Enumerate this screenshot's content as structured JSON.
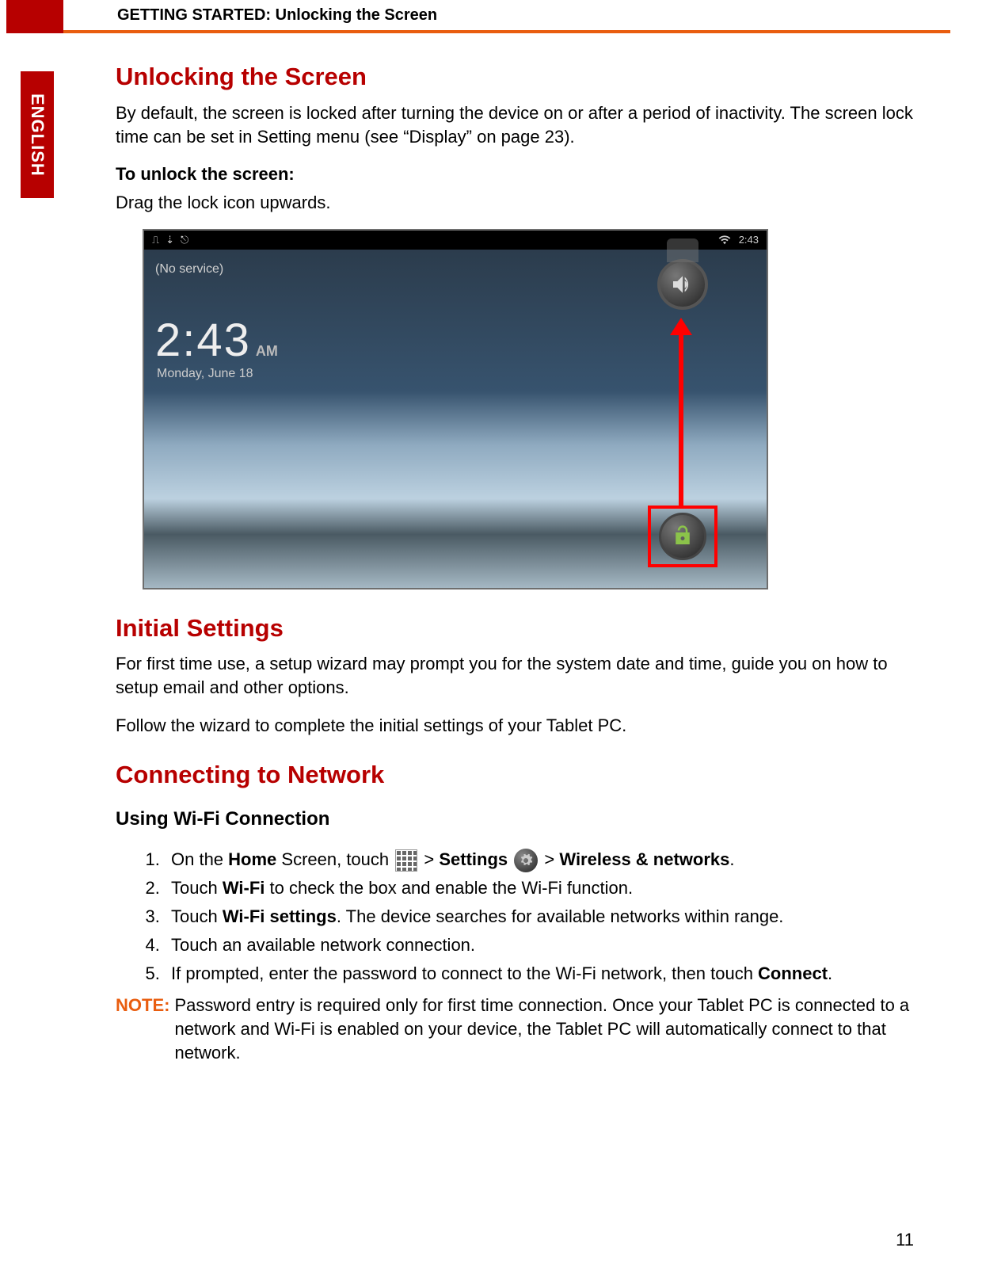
{
  "header": {
    "breadcrumb": "GETTING STARTED: Unlocking the Screen"
  },
  "language_tab": "ENGLISH",
  "section1": {
    "title": "Unlocking the Screen",
    "intro": "By default, the screen is locked after turning the device on or after a period of inactivity. The screen lock time can be set in Setting menu (see “Display” on page 23).",
    "to_unlock_label": "To unlock the screen:",
    "to_unlock_body": "Drag the lock icon upwards."
  },
  "screenshot": {
    "status_time": "2:43",
    "no_service": "(No service)",
    "clock_time": "2:43",
    "clock_ampm": "AM",
    "clock_date": "Monday, June 18"
  },
  "section2": {
    "title": "Initial Settings",
    "p1": "For first time use, a setup wizard may prompt you for the system date and time, guide you on how to setup email and other options.",
    "p2": "Follow the wizard to complete the initial settings of your Tablet PC."
  },
  "section3": {
    "title": "Connecting to Network",
    "subheading": "Using Wi-Fi Connection",
    "step1_a": "On the ",
    "step1_home": "Home",
    "step1_b": " Screen, touch ",
    "step1_gt1": "> ",
    "step1_settings": "Settings",
    "step1_gt2": " > ",
    "step1_wireless": "Wireless & networks",
    "step1_end": ".",
    "step2_a": "Touch ",
    "step2_wifi": "Wi-Fi",
    "step2_b": " to check the box and enable the Wi-Fi function.",
    "step3_a": "Touch ",
    "step3_wifiset": "Wi-Fi settings",
    "step3_b": ". The device searches for available networks within range.",
    "step4": "Touch an available network connection.",
    "step5_a": "If prompted, enter the password to connect to the Wi-Fi network, then touch ",
    "step5_connect": "Connect",
    "step5_b": ".",
    "note_label": "NOTE:",
    "note_body": "Password entry is required only for first time connection. Once your Tablet PC is connected to a network and Wi-Fi is enabled on your device, the Tablet PC will automatically connect to that network."
  },
  "page_number": "11"
}
